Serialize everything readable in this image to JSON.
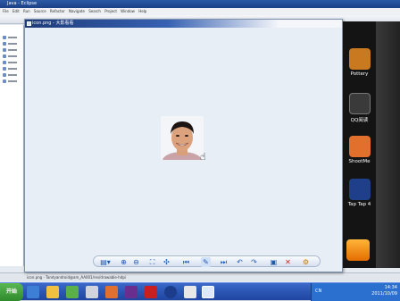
{
  "eclipse": {
    "title": "Java - Eclipse",
    "menu": "File  Edit  Run  Source  Refactor  Navigate  Search  Project  Window  Help",
    "status_path": "icon.png - Tandyandroid@am_AA001/res/drawable-hdpi"
  },
  "viewer": {
    "title": "icon.png - 大影看看",
    "tools": [
      "view-menu",
      "zoom-in",
      "zoom-out",
      "fit",
      "actual-size",
      "first",
      "edit",
      "last",
      "rotate-left",
      "rotate-right",
      "save",
      "delete",
      "settings"
    ]
  },
  "phone": {
    "apps": [
      {
        "label": "Pottery",
        "color": "#c9791f"
      },
      {
        "label": "QQ阅读",
        "color": "#3a3a3a"
      },
      {
        "label": "ShootMe",
        "color": "#e0702c"
      },
      {
        "label": "Tap Tap 4",
        "color": "#1f3f8a"
      }
    ]
  },
  "taskbar": {
    "start": "开始",
    "lang": "CN",
    "time": "14:34",
    "date": "2011/10/09"
  }
}
